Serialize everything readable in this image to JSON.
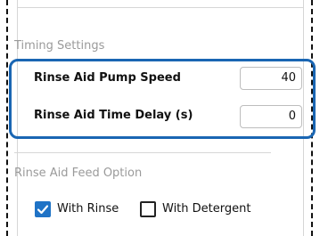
{
  "timing_section": {
    "title": "Timing Settings",
    "rows": [
      {
        "label": "Rinse Aid Pump Speed",
        "value": "40"
      },
      {
        "label": "Rinse Aid Time Delay (s)",
        "value": "0"
      }
    ]
  },
  "feed_section": {
    "title": "Rinse Aid Feed Option",
    "options": [
      {
        "label": "With Rinse",
        "checked": true
      },
      {
        "label": "With Detergent",
        "checked": false
      }
    ]
  },
  "colors": {
    "highlight": "#1a66b3",
    "checkbox_checked": "#1f73c6",
    "section_title": "#9a9a9a"
  },
  "icons": [
    "check-icon"
  ]
}
